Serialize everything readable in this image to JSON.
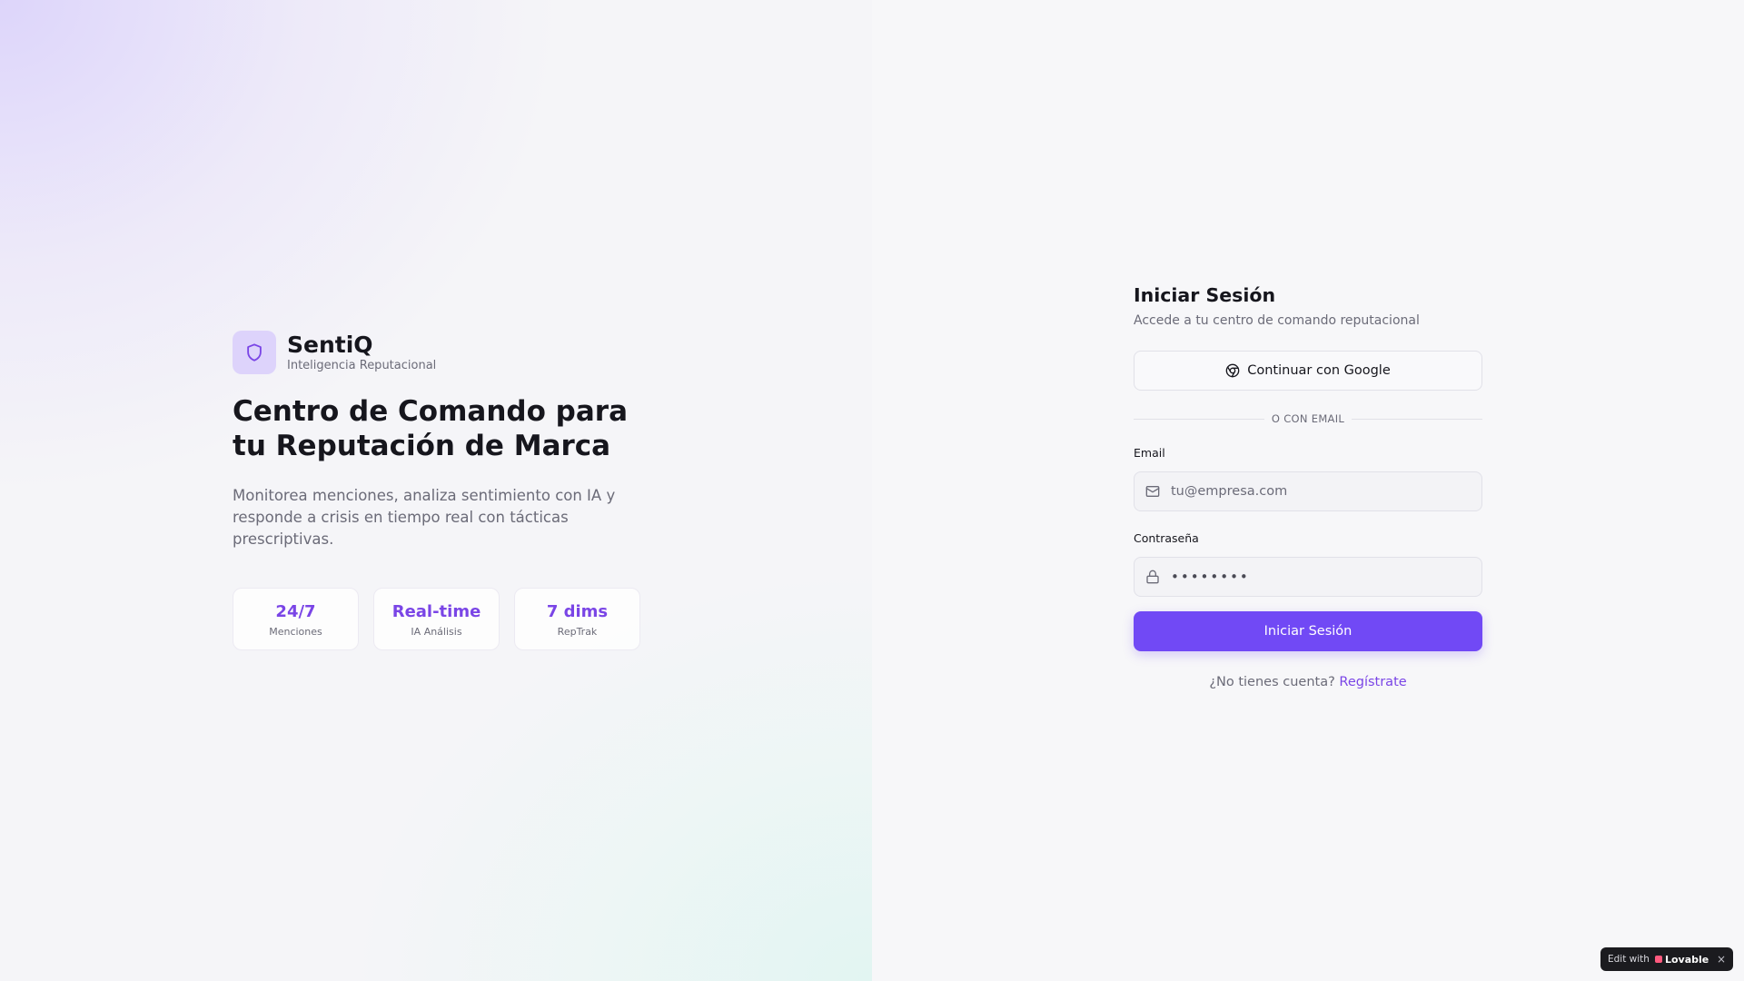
{
  "brand": {
    "name": "SentiQ",
    "tagline": "Inteligencia Reputacional",
    "icon": "shield-icon"
  },
  "hero": {
    "headline": "Centro de Comando para tu Reputación de Marca",
    "description": "Monitorea menciones, analiza sentimiento con IA y responde a crisis en tiempo real con tácticas prescriptivas."
  },
  "stats": [
    {
      "value": "24/7",
      "label": "Menciones"
    },
    {
      "value": "Real-time",
      "label": "IA Análisis"
    },
    {
      "value": "7 dims",
      "label": "RepTrak"
    }
  ],
  "login": {
    "title": "Iniciar Sesión",
    "subtitle": "Accede a tu centro de comando reputacional",
    "google_label": "Continuar con Google",
    "divider": "O CON EMAIL",
    "email_label": "Email",
    "email_placeholder": "tu@empresa.com",
    "password_label": "Contraseña",
    "password_mask": "••••••••",
    "submit_label": "Iniciar Sesión",
    "signup_prompt": "¿No tienes cuenta?",
    "signup_link": "Regístrate"
  },
  "badge": {
    "prefix": "Edit with",
    "brand": "Lovable",
    "close": "×"
  },
  "colors": {
    "accent": "#7149f5",
    "accent_text": "#7a45e6",
    "logo_bg": "#ddd3fb"
  }
}
